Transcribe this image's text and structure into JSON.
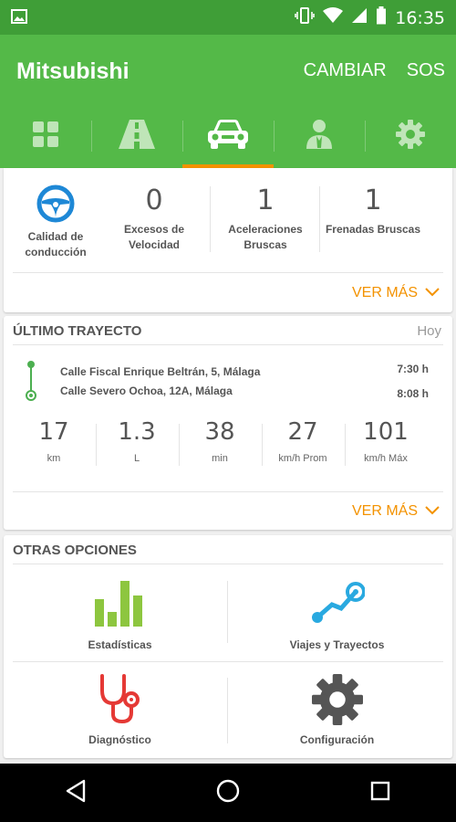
{
  "status_bar": {
    "time": "16:35"
  },
  "app_bar": {
    "title": "Mitsubishi",
    "actions": [
      "CAMBIAR",
      "SOS"
    ]
  },
  "tabs": [
    {
      "icon": "dashboard-grid-icon"
    },
    {
      "icon": "road-icon"
    },
    {
      "icon": "car-icon",
      "active": true
    },
    {
      "icon": "driver-icon"
    },
    {
      "icon": "gear-icon"
    }
  ],
  "driving_summary": {
    "quality_label": "Calidad de conducción",
    "stats": [
      {
        "value": "0",
        "label": "Excesos de Velocidad"
      },
      {
        "value": "1",
        "label": "Aceleraciones Bruscas"
      },
      {
        "value": "1",
        "label": "Frenadas Bruscas"
      }
    ],
    "more_label": "VER MÁS"
  },
  "last_trip": {
    "title": "ÚLTIMO TRAYECTO",
    "date": "Hoy",
    "origin": "Calle Fiscal Enrique Beltrán, 5, Málaga",
    "origin_time": "7:30 h",
    "destination": "Calle Severo Ochoa, 12A, Málaga",
    "destination_time": "8:08 h",
    "metrics": [
      {
        "value": "17",
        "unit": "km"
      },
      {
        "value": "1.3",
        "unit": "L"
      },
      {
        "value": "38",
        "unit": "min"
      },
      {
        "value": "27",
        "unit": "km/h Prom"
      },
      {
        "value": "101",
        "unit": "km/h Máx"
      }
    ],
    "more_label": "VER MÁS"
  },
  "other_options": {
    "title": "OTRAS OPCIONES",
    "items": [
      {
        "label": "Estadísticas",
        "icon": "bar-chart-icon"
      },
      {
        "label": "Viajes y Trayectos",
        "icon": "route-icon"
      },
      {
        "label": "Diagnóstico",
        "icon": "stethoscope-icon"
      },
      {
        "label": "Configuración",
        "icon": "gear-icon"
      }
    ]
  },
  "colors": {
    "brand_green": "#54b948",
    "status_green": "#3f9e37",
    "accent_orange": "#f39200",
    "icon_blue": "#1e88d6",
    "icon_lime": "#8dc63f",
    "icon_red": "#e53935"
  }
}
